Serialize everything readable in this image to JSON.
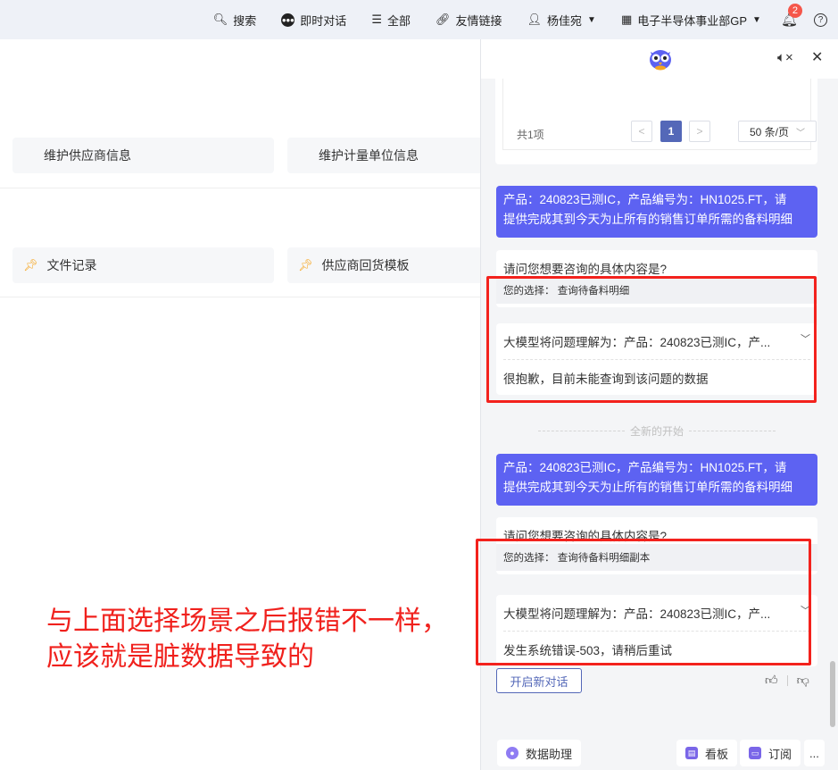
{
  "topbar": {
    "search": "搜索",
    "chat": "即时对话",
    "all": "全部",
    "links": "友情链接",
    "user": "杨佳宛",
    "org": "电子半导体事业部GP",
    "notif_count": "2"
  },
  "left": {
    "cards_row1": [
      "维护供应商信息",
      "维护计量单位信息"
    ],
    "cards_row2": [
      "文件记录",
      "供应商回货模板"
    ]
  },
  "annotation": {
    "line1": "与上面选择场景之后报错不一样，",
    "line2": "应该就是脏数据导致的"
  },
  "panel": {
    "pagination": {
      "total": "共1项",
      "prev": "<",
      "current": "1",
      "next": ">",
      "page_size": "50 条/页"
    },
    "conv1": {
      "user_line1": "产品：240823已测IC，产品编号为：HN1025.FT，请",
      "user_line2": "提供完成其到今天为止所有的销售订单所需的备料明细",
      "question": "请问您想要咨询的具体内容是?",
      "choice": "您的选择：  查询待备料明细",
      "interpretation": "大模型将问题理解为：产品：240823已测IC，产...",
      "answer": "很抱歉，目前未能查询到该问题的数据"
    },
    "divider": "全新的开始",
    "conv2": {
      "user_line1": "产品：240823已测IC，产品编号为：HN1025.FT，请",
      "user_line2": "提供完成其到今天为止所有的销售订单所需的备料明细",
      "question": "请问您想要咨询的具体内容是?",
      "choice": "您的选择：  查询待备料明细副本",
      "interpretation": "大模型将问题理解为：产品：240823已测IC，产...",
      "answer": "发生系统错误-503，请稍后重试"
    },
    "new_chat": "开启新对话",
    "bottom": {
      "assistant": "数据助理",
      "board": "看板",
      "subscribe": "订阅",
      "more": "..."
    }
  },
  "colors": {
    "accent": "#5d62f2",
    "annotation_red": "#f3221d",
    "topbar_bg": "#eef1f7"
  }
}
